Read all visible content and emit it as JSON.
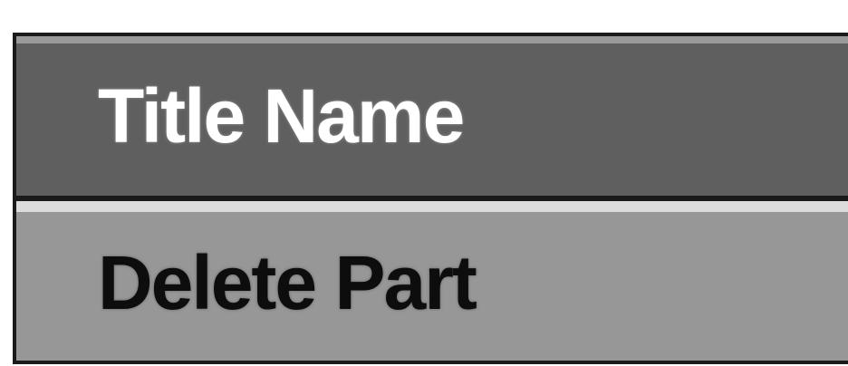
{
  "menu": {
    "items": [
      {
        "label": "Title Name",
        "selected": true
      },
      {
        "label": "Delete Part",
        "selected": false
      }
    ]
  },
  "colors": {
    "selected_background": "#5f5f5f",
    "item_background": "#979797",
    "frame": "#1a1a1a",
    "selected_text": "#ffffff",
    "item_text": "#0d0d0d"
  }
}
